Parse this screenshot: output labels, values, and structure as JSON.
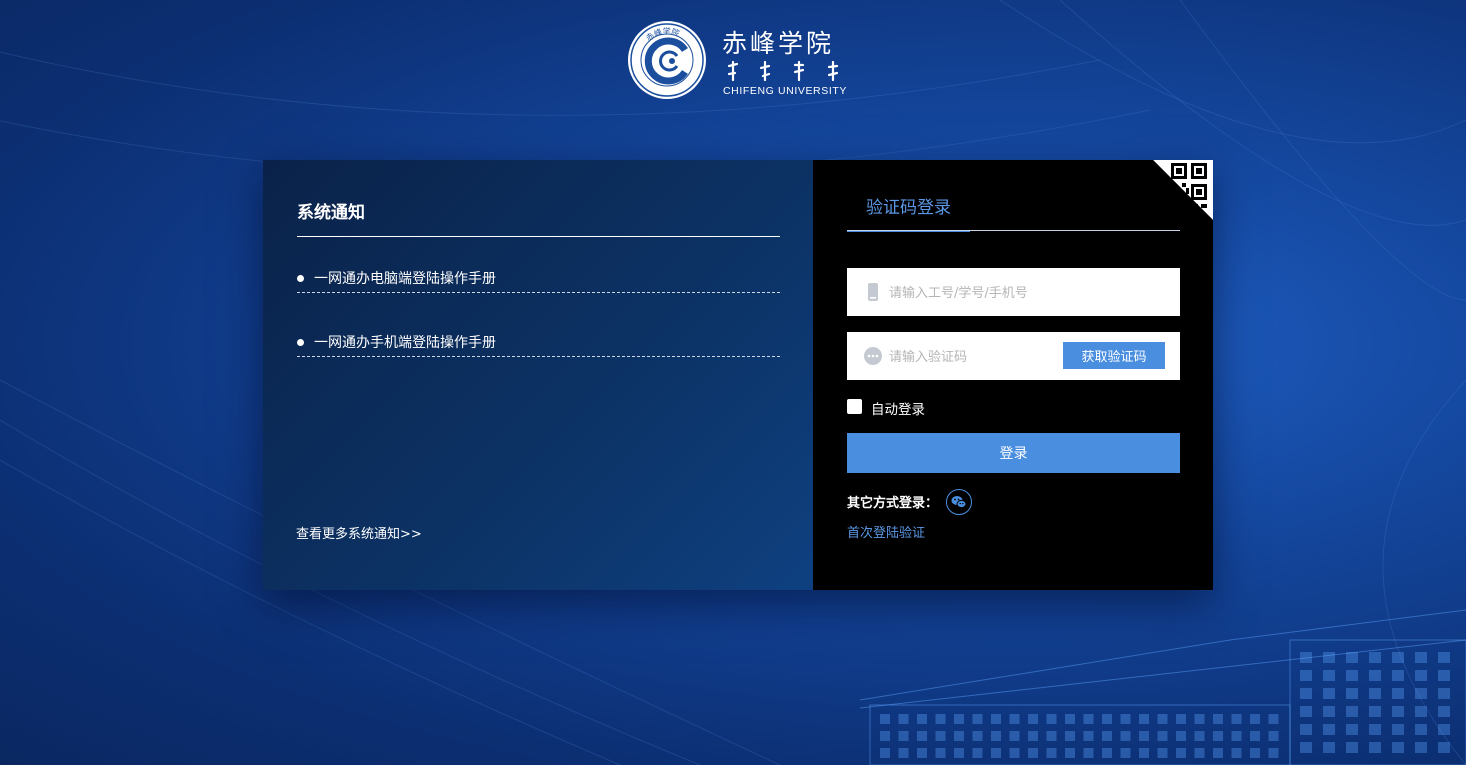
{
  "logo": {
    "name_cn": "赤峰学院",
    "name_en": "CHIFENG UNIVERSITY",
    "seal_text": "赤峰学院"
  },
  "notice": {
    "title": "系统通知",
    "items": [
      {
        "text": "一网通办电脑端登陆操作手册"
      },
      {
        "text": "一网通办手机端登陆操作手册"
      }
    ],
    "more": "查看更多系统通知>>"
  },
  "login": {
    "tab_label": "验证码登录",
    "account_placeholder": "请输入工号/学号/手机号",
    "code_placeholder": "请输入验证码",
    "get_code_label": "获取验证码",
    "auto_login_label": "自动登录",
    "submit_label": "登录",
    "other_methods_label": "其它方式登录：",
    "first_login_link": "首次登陆验证"
  },
  "icons": {
    "phone": "phone-icon",
    "message": "message-icon",
    "wechat": "wechat-icon",
    "qr": "qr-code-icon"
  },
  "colors": {
    "accent": "#4a8ee0",
    "background": "#14479e",
    "login_panel": "#000000",
    "notice_panel": "#0c3366"
  }
}
